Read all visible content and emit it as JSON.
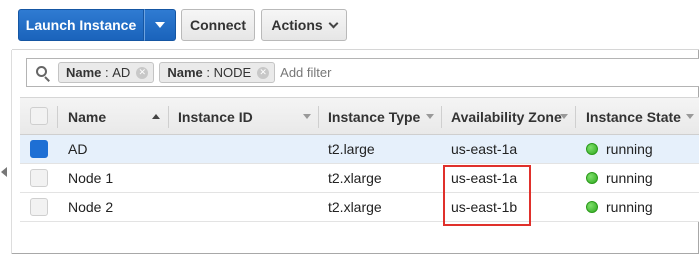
{
  "toolbar": {
    "launch_label": "Launch Instance",
    "connect_label": "Connect",
    "actions_label": "Actions"
  },
  "filter": {
    "chips": [
      {
        "key": "Name",
        "value": "AD"
      },
      {
        "key": "Name",
        "value": "NODE"
      }
    ],
    "placeholder": "Add filter"
  },
  "table": {
    "columns": [
      "Name",
      "Instance ID",
      "Instance Type",
      "Availability Zone",
      "Instance State"
    ],
    "rows": [
      {
        "name": "AD",
        "instance_id": "",
        "type": "t2.large",
        "zone": "us-east-1a",
        "state": "running",
        "selected": true
      },
      {
        "name": "Node 1",
        "instance_id": "",
        "type": "t2.xlarge",
        "zone": "us-east-1a",
        "state": "running",
        "selected": false
      },
      {
        "name": "Node 2",
        "instance_id": "",
        "type": "t2.xlarge",
        "zone": "us-east-1b",
        "state": "running",
        "selected": false
      }
    ]
  },
  "colors": {
    "primary_button": "#1a63bb",
    "selected_row": "#e6f0fb",
    "running_status": "#2fa81f",
    "highlight_box": "#e0302b"
  }
}
